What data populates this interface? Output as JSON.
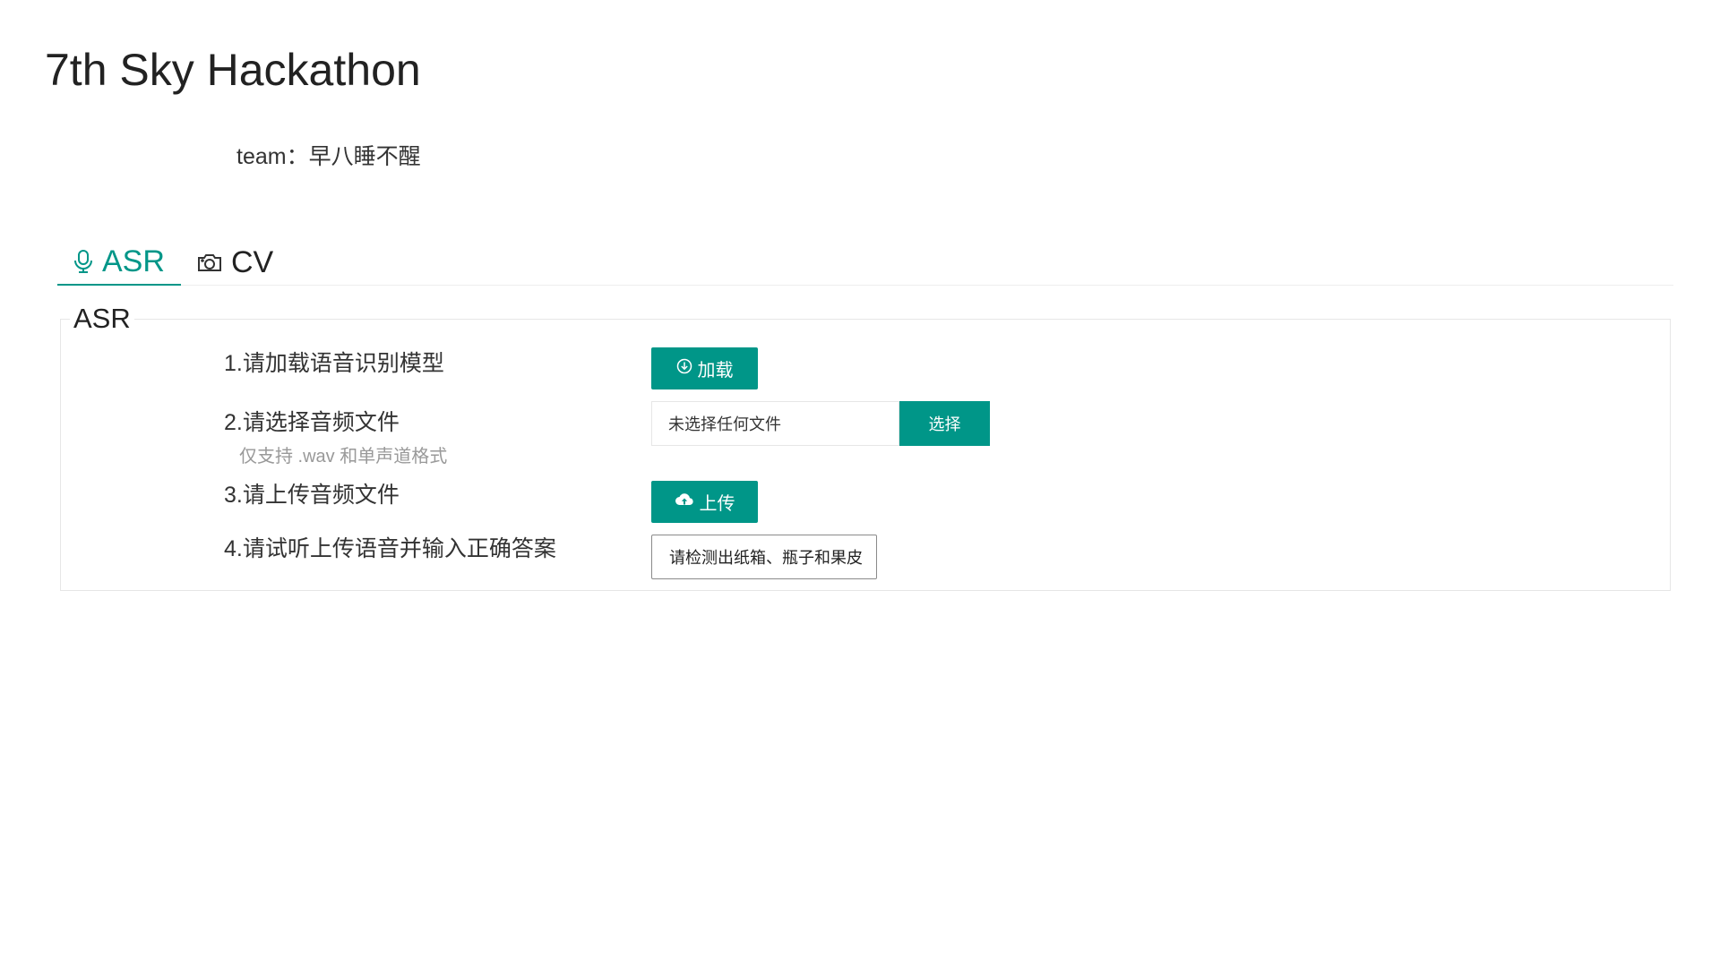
{
  "header": {
    "title": "7th Sky Hackathon",
    "team": "team：早八睡不醒"
  },
  "tabs": [
    {
      "label": "ASR",
      "icon": "microphone-icon",
      "active": true
    },
    {
      "label": "CV",
      "icon": "camera-icon",
      "active": false
    }
  ],
  "asr": {
    "legend": "ASR",
    "steps": [
      {
        "label": "1.请加载语音识别模型"
      },
      {
        "label": "2.请选择音频文件",
        "hint": "仅支持 .wav 和单声道格式"
      },
      {
        "label": "3.请上传音频文件"
      },
      {
        "label": "4.请试听上传语音并输入正确答案"
      }
    ],
    "load_button": "加载",
    "file_input_placeholder": "未选择任何文件",
    "choose_button": "选择",
    "upload_button": "上传",
    "answer_value": "请检测出纸箱、瓶子和果皮"
  },
  "colors": {
    "accent": "#009688",
    "text": "#222222",
    "hint": "#999999",
    "border": "#e6e6e6"
  }
}
